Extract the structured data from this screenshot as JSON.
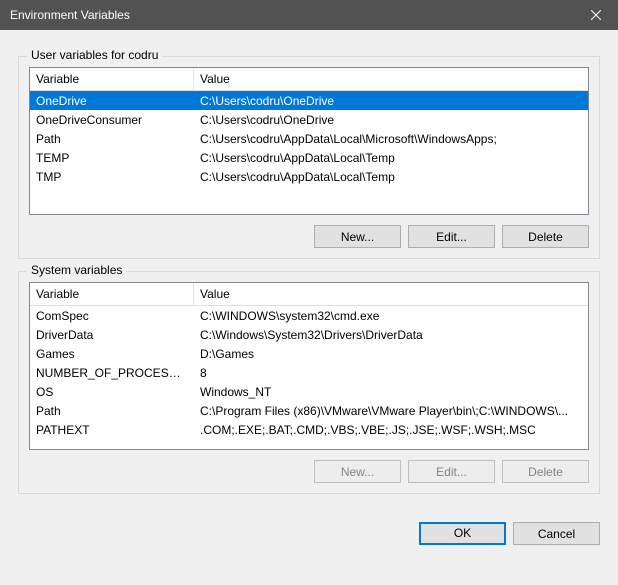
{
  "window": {
    "title": "Environment Variables"
  },
  "userSection": {
    "legend": "User variables for codru",
    "columns": {
      "variable": "Variable",
      "value": "Value"
    },
    "rows": [
      {
        "variable": "OneDrive",
        "value": "C:\\Users\\codru\\OneDrive",
        "selected": true
      },
      {
        "variable": "OneDriveConsumer",
        "value": "C:\\Users\\codru\\OneDrive",
        "selected": false
      },
      {
        "variable": "Path",
        "value": "C:\\Users\\codru\\AppData\\Local\\Microsoft\\WindowsApps;",
        "selected": false
      },
      {
        "variable": "TEMP",
        "value": "C:\\Users\\codru\\AppData\\Local\\Temp",
        "selected": false
      },
      {
        "variable": "TMP",
        "value": "C:\\Users\\codru\\AppData\\Local\\Temp",
        "selected": false
      }
    ],
    "buttons": {
      "new": "New...",
      "edit": "Edit...",
      "delete": "Delete"
    }
  },
  "systemSection": {
    "legend": "System variables",
    "columns": {
      "variable": "Variable",
      "value": "Value"
    },
    "rows": [
      {
        "variable": "ComSpec",
        "value": "C:\\WINDOWS\\system32\\cmd.exe"
      },
      {
        "variable": "DriverData",
        "value": "C:\\Windows\\System32\\Drivers\\DriverData"
      },
      {
        "variable": "Games",
        "value": "D:\\Games"
      },
      {
        "variable": "NUMBER_OF_PROCESSORS",
        "value": "8"
      },
      {
        "variable": "OS",
        "value": "Windows_NT"
      },
      {
        "variable": "Path",
        "value": "C:\\Program Files (x86)\\VMware\\VMware Player\\bin\\;C:\\WINDOWS\\..."
      },
      {
        "variable": "PATHEXT",
        "value": ".COM;.EXE;.BAT;.CMD;.VBS;.VBE;.JS;.JSE;.WSF;.WSH;.MSC"
      },
      {
        "variable": "",
        "value": ""
      },
      {
        "variable": "",
        "value": ""
      }
    ],
    "buttons": {
      "new": "New...",
      "edit": "Edit...",
      "delete": "Delete"
    }
  },
  "dialogButtons": {
    "ok": "OK",
    "cancel": "Cancel"
  }
}
